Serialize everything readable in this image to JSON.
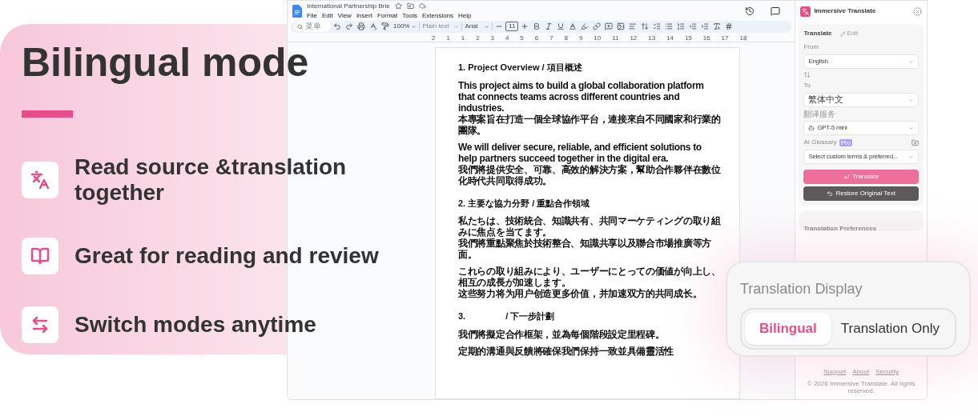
{
  "hero": {
    "title": "Bilingual mode",
    "features": [
      {
        "text": "Read source &translation together"
      },
      {
        "text": "Great for reading and review"
      },
      {
        "text": "Switch modes anytime"
      }
    ]
  },
  "doc_window": {
    "title": "International Partnership Brie",
    "menu": [
      "File",
      "Edit",
      "View",
      "Insert",
      "Format",
      "Tools",
      "Extensions",
      "Help"
    ],
    "toolbar": {
      "search_placeholder": "菜单",
      "zoom": "100%",
      "style": "Plain text",
      "font": "Arial",
      "font_size": "11"
    },
    "ruler": [
      "2",
      "1",
      "1",
      "2",
      "3",
      "4",
      "5",
      "6",
      "7",
      "8",
      "9",
      "10",
      "11",
      "12",
      "13",
      "14",
      "15",
      "16",
      "17",
      "18"
    ],
    "document": [
      {
        "kind": "heading",
        "text": "1. Project Overview / 項目概述"
      },
      {
        "kind": "paragraph",
        "lines": [
          "This project aims to build a global collaboration platform that connects teams across different countries and industries.",
          "本專案旨在打造一個全球協作平台，連接來自不同國家和行業的團隊。"
        ]
      },
      {
        "kind": "paragraph",
        "lines": [
          "We will deliver secure, reliable, and efficient solutions to help partners succeed together in the digital era.",
          "我們將提供安全、可靠、高效的解決方案，幫助合作夥伴在數位化時代共同取得成功。"
        ]
      },
      {
        "kind": "heading",
        "text": "2. 主要な協力分野 / 重點合作領域"
      },
      {
        "kind": "paragraph",
        "lines": [
          "私たちは、技術統合、知識共有、共同マーケティングの取り組みに焦点を当てます。",
          "我們將重點聚焦於技術整合、知識共享以及聯合市場推廣等方面。"
        ]
      },
      {
        "kind": "paragraph",
        "lines": [
          "これらの取り組みにより、ユーザーにとっての価値が向上し、相互の成長が加速します。",
          "这些努力将为用户创造更多价值，并加速双方的共同成长。"
        ]
      },
      {
        "kind": "heading",
        "number": "3.",
        "text": "/ 下一步計劃"
      },
      {
        "kind": "paragraph",
        "lines": [
          "我們將擬定合作框架，並為每個階段設定里程碑。"
        ]
      },
      {
        "kind": "paragraph",
        "lines": [
          "定期的溝通與反饋將確保我們保持一致並具備靈活性"
        ]
      }
    ]
  },
  "sidebar": {
    "app_name": "Immersive Translate",
    "section": "Translate",
    "ghost_label": "Edit",
    "from_label": "From",
    "from_value": "English",
    "to_label": "To",
    "to_value": "繁体中文",
    "service_label": "翻译服务",
    "service_value": "GPT-5 mini",
    "glossary_label": "AI Glossary",
    "glossary_badge": "Pro",
    "glossary_placeholder": "Select custom terms & preferred...",
    "translate_button": "Translate",
    "restore_button": "Restore Original Text",
    "preferences_title": "Translation Preferences",
    "footer_links": [
      "Support",
      "About",
      "Security"
    ],
    "copyright": "© 2026 Immersive Translate. All rights reserved."
  },
  "display_popup": {
    "title": "Translation Display",
    "options": [
      {
        "label": "Bilingual",
        "selected": true
      },
      {
        "label": "Translation Only",
        "selected": false
      }
    ]
  }
}
